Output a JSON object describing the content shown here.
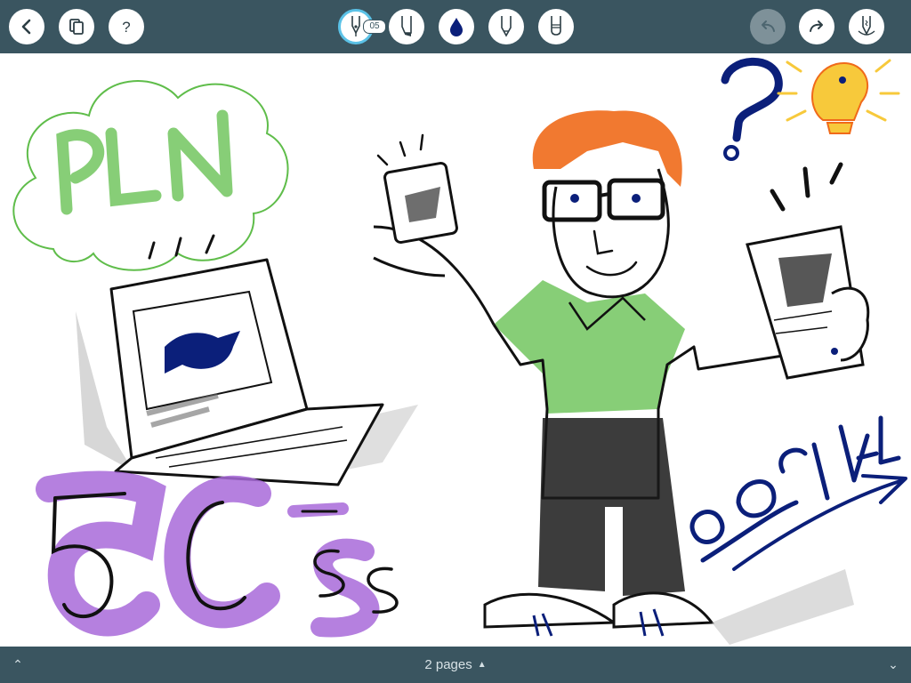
{
  "toolbar": {
    "tools": [
      "back-icon",
      "pages-icon",
      "help-icon",
      "fountain-pen-icon",
      "marker-icon",
      "ink-color-icon",
      "pencil-icon",
      "eraser-icon",
      "undo-icon",
      "redo-icon",
      "stylus-icon"
    ],
    "pen_size": "05"
  },
  "footer": {
    "pages_label": "2 pages"
  },
  "colors": {
    "bar": "#3a5560",
    "ink_navy": "#0b1f7a",
    "green": "#5fbd4a",
    "purple": "#a86ad9",
    "orange": "#f06a1a",
    "yellow": "#f7c93b",
    "gray": "#b9b9b9"
  }
}
